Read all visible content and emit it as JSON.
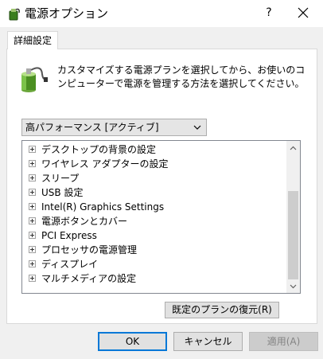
{
  "window": {
    "title": "電源オプション",
    "help_glyph": "?",
    "icons": {
      "app": "power-options-icon",
      "close": "close-icon"
    }
  },
  "tab": {
    "label": "詳細設定"
  },
  "description": "カスタマイズする電源プランを選択してから、お使いのコンピューターで電源を管理する方法を選択してください。",
  "plan_select": {
    "value": "高パフォーマンス [アクティブ]"
  },
  "settings_tree": [
    "デスクトップの背景の設定",
    "ワイヤレス アダプターの設定",
    "スリープ",
    "USB 設定",
    "Intel(R) Graphics Settings",
    "電源ボタンとカバー",
    "PCI Express",
    "プロセッサの電源管理",
    "ディスプレイ",
    "マルチメディアの設定"
  ],
  "restore_button": "既定のプランの復元(R)",
  "buttons": {
    "ok": "OK",
    "cancel": "キャンセル",
    "apply": "適用(A)"
  },
  "colors": {
    "focus_border": "#0078d7",
    "disabled_text": "#838383"
  }
}
